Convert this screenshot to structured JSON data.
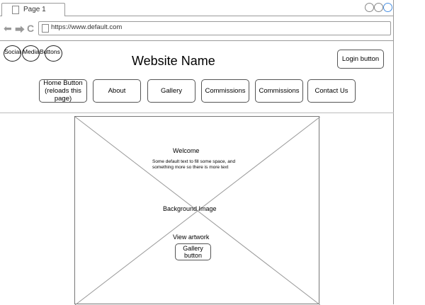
{
  "browser": {
    "tab_label": "Page 1",
    "url": "https://www.default.com",
    "nav_icons": [
      "back-arrow-icon",
      "forward-arrow-icon",
      "refresh-icon"
    ]
  },
  "header": {
    "social": {
      "labels": [
        "Social",
        "Media",
        "Buttons"
      ]
    },
    "site_name": "Website Name",
    "login_label": "Login button"
  },
  "nav": {
    "items": [
      {
        "label": "Home Button (reloads this page)"
      },
      {
        "label": "About"
      },
      {
        "label": "Gallery"
      },
      {
        "label": "Commissions"
      },
      {
        "label": "Commissions"
      },
      {
        "label": "Contact Us"
      }
    ]
  },
  "hero": {
    "welcome": "Welcome",
    "filler": "Some default text to fill some space, and something more so there is more text",
    "bg_label": "Background Image",
    "view_artwork": "View artwork",
    "gallery_button": "Gallery button"
  }
}
